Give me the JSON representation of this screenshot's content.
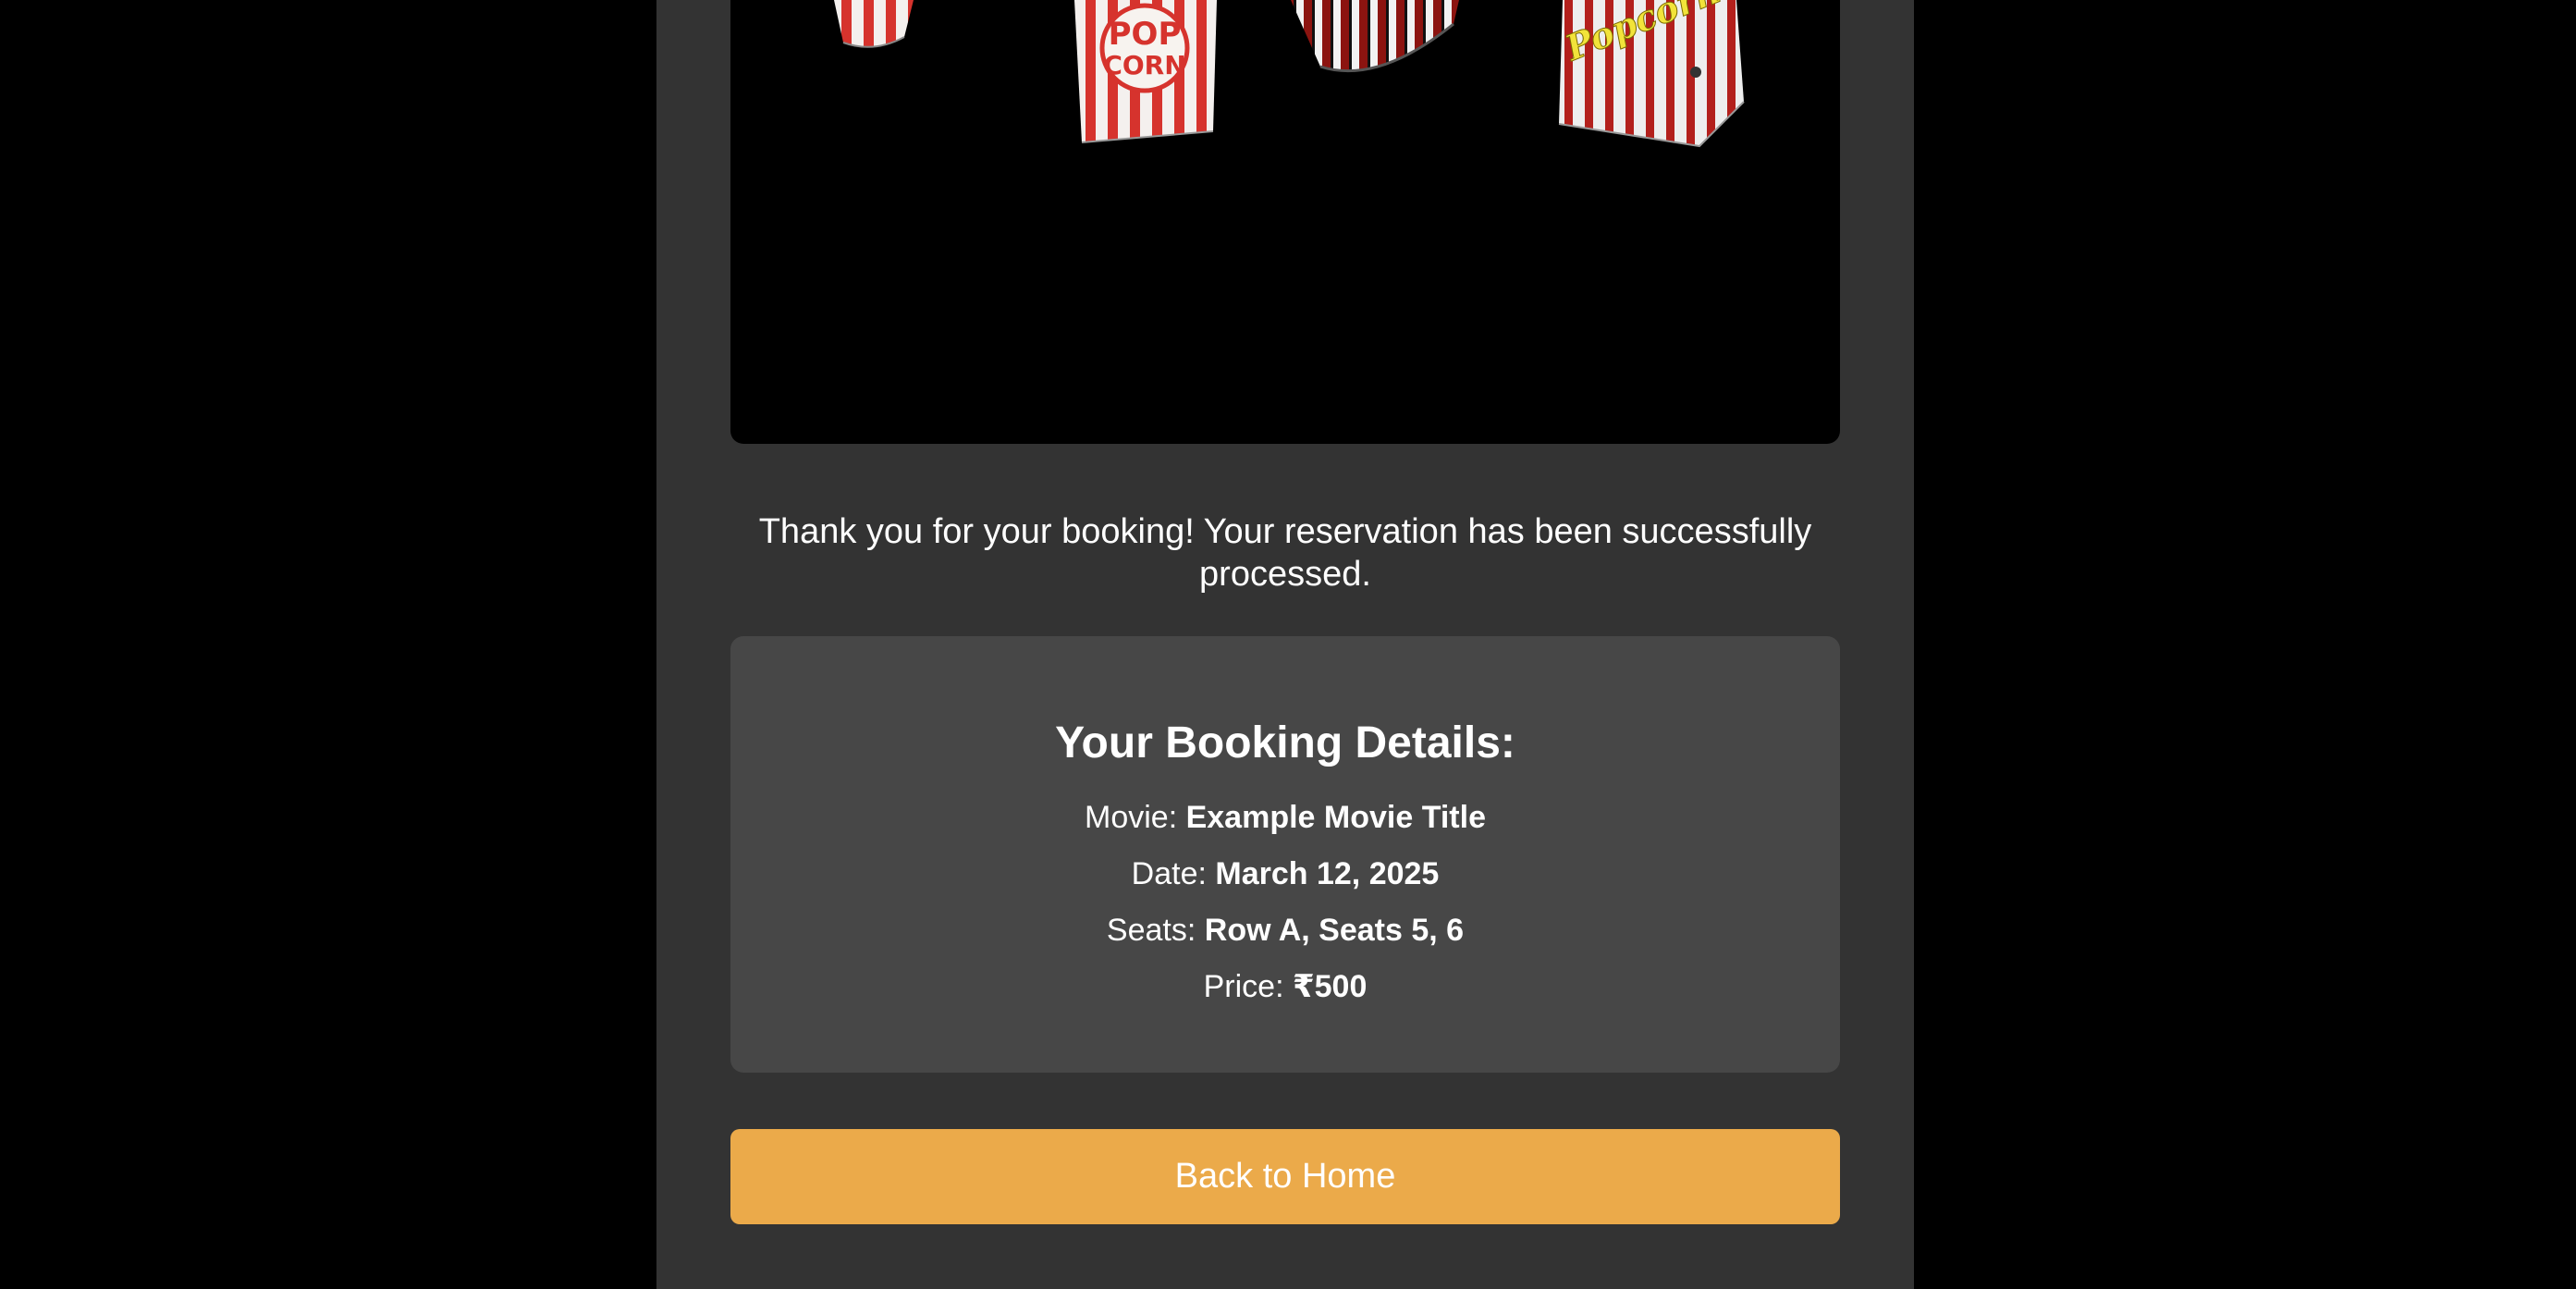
{
  "hero_image": {
    "kind": "popcorn-buckets-photo",
    "popcorn_label": "POP CORN",
    "popcorn_script_label": "Popcorn"
  },
  "confirmation": {
    "message": "Thank you for your booking! Your reservation has been successfully processed."
  },
  "booking": {
    "heading": "Your Booking Details:",
    "movie_label": "Movie:",
    "movie_value": "Example Movie Title",
    "date_label": "Date:",
    "date_value": "March 12, 2025",
    "seats_label": "Seats:",
    "seats_value": "Row A, Seats 5, 6",
    "price_label": "Price:",
    "price_value": "₹500"
  },
  "actions": {
    "back_home_label": "Back to Home"
  },
  "colors": {
    "page_bg": "#000000",
    "panel_bg": "#333333",
    "card_bg": "#474747",
    "button_bg": "#ebaa4a",
    "popcorn_red": "#d6332d"
  }
}
